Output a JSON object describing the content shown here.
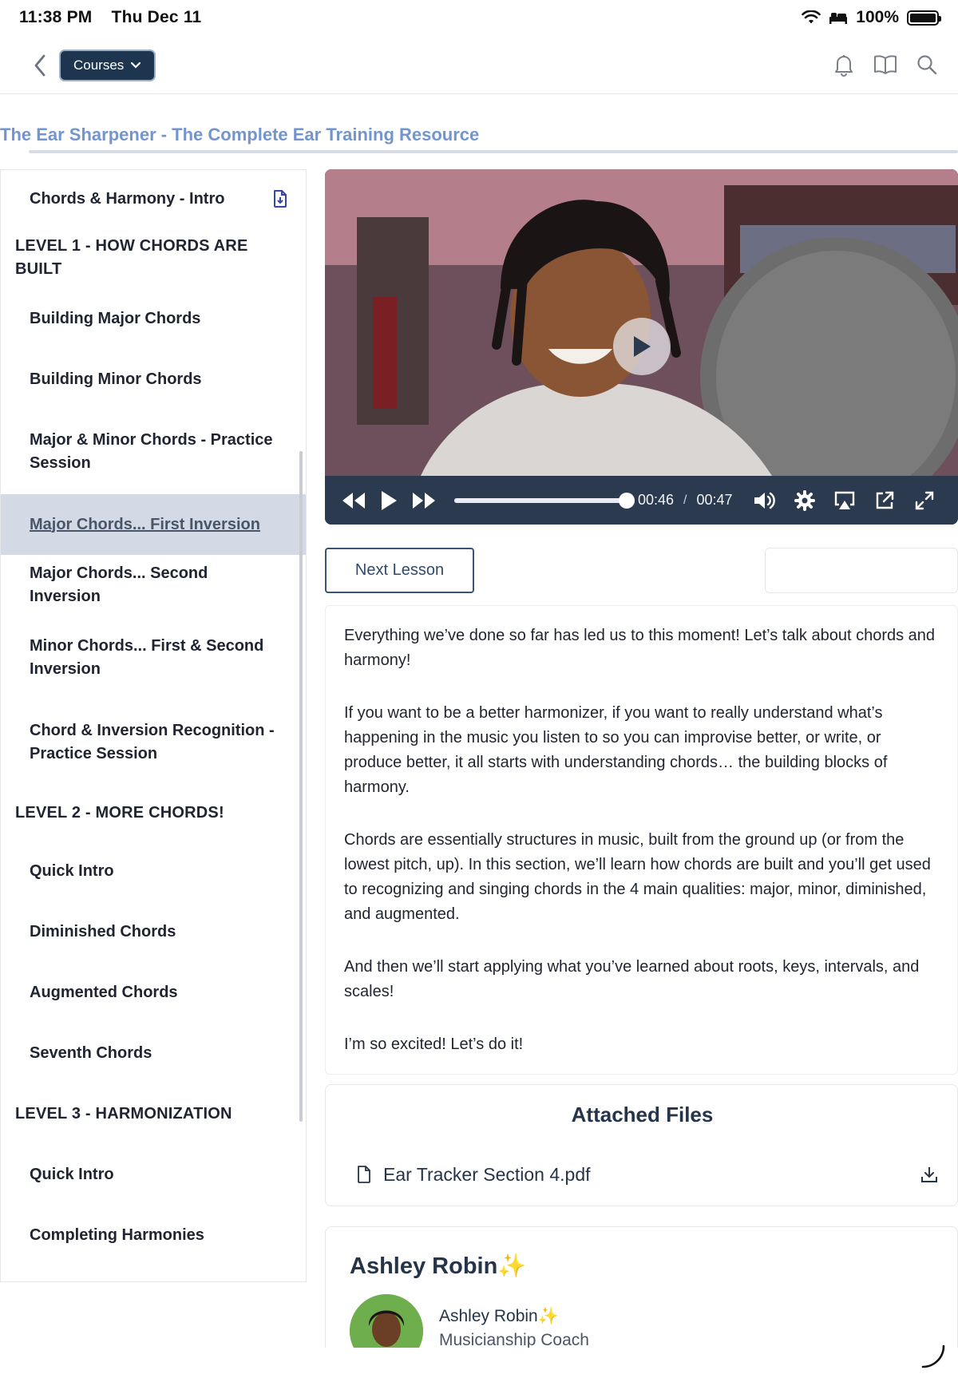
{
  "status_bar": {
    "time": "11:38 PM",
    "date": "Thu Dec 11",
    "battery": "100%"
  },
  "nav": {
    "courses_label": "Courses"
  },
  "course": {
    "title": "The Ear Sharpener - The Complete Ear Training Resource"
  },
  "sidebar": {
    "items": [
      {
        "label": "Chords & Harmony - Intro",
        "type": "lesson",
        "doc": true
      },
      {
        "label": "LEVEL 1 - HOW CHORDS ARE BUILT",
        "type": "level"
      },
      {
        "label": "Building Major Chords",
        "type": "lesson"
      },
      {
        "label": "Building Minor Chords",
        "type": "lesson"
      },
      {
        "label": "Major & Minor Chords - Practice Session",
        "type": "lesson"
      },
      {
        "label": "Major Chords... First Inversion",
        "type": "lesson",
        "active": true
      },
      {
        "label": "Major Chords... Second Inversion",
        "type": "lesson"
      },
      {
        "label": "Minor Chords... First & Second Inversion",
        "type": "lesson"
      },
      {
        "label": "Chord & Inversion Recognition - Practice Session",
        "type": "lesson"
      },
      {
        "label": "LEVEL 2 - MORE CHORDS!",
        "type": "level"
      },
      {
        "label": "Quick Intro",
        "type": "lesson"
      },
      {
        "label": "Diminished Chords",
        "type": "lesson"
      },
      {
        "label": "Augmented Chords",
        "type": "lesson"
      },
      {
        "label": "Seventh Chords",
        "type": "lesson"
      },
      {
        "label": "LEVEL 3 - HARMONIZATION",
        "type": "level"
      },
      {
        "label": "Quick Intro",
        "type": "lesson"
      },
      {
        "label": "Completing Harmonies",
        "type": "lesson"
      }
    ]
  },
  "video": {
    "current_time": "00:46",
    "separator": "/",
    "duration": "00:47",
    "progress_fraction": 0.98
  },
  "lesson": {
    "next_label": "Next Lesson",
    "paragraphs": [
      "Everything we’ve done so far has led us to this moment! Let’s talk about chords and harmony!",
      "If you want to be a better harmonizer, if you want to really understand what’s happening in the music you listen to so you can improvise better, or write, or produce better, it all starts with understanding chords… the building blocks of harmony.",
      "Chords are essentially structures in music, built from the ground up (or from the lowest pitch, up). In this section, we’ll learn how chords are built and you’ll get used to recognizing and singing chords in the 4 main qualities: major, minor, diminished, and augmented.",
      "And then we’ll start applying what you’ve learned about roots, keys, intervals, and scales!",
      "I’m so excited! Let’s do it!"
    ]
  },
  "files": {
    "title": "Attached Files",
    "items": [
      {
        "name": "Ear Tracker Section 4.pdf"
      }
    ]
  },
  "instructor": {
    "heading": "Ashley Robin",
    "name": "Ashley Robin",
    "role": "Musicianship Coach",
    "sparkle": "✨"
  },
  "colors": {
    "accent": "#1e3550",
    "title": "#7395cf",
    "active_row": "#d3dae5",
    "controls": "#2b3a4e"
  }
}
